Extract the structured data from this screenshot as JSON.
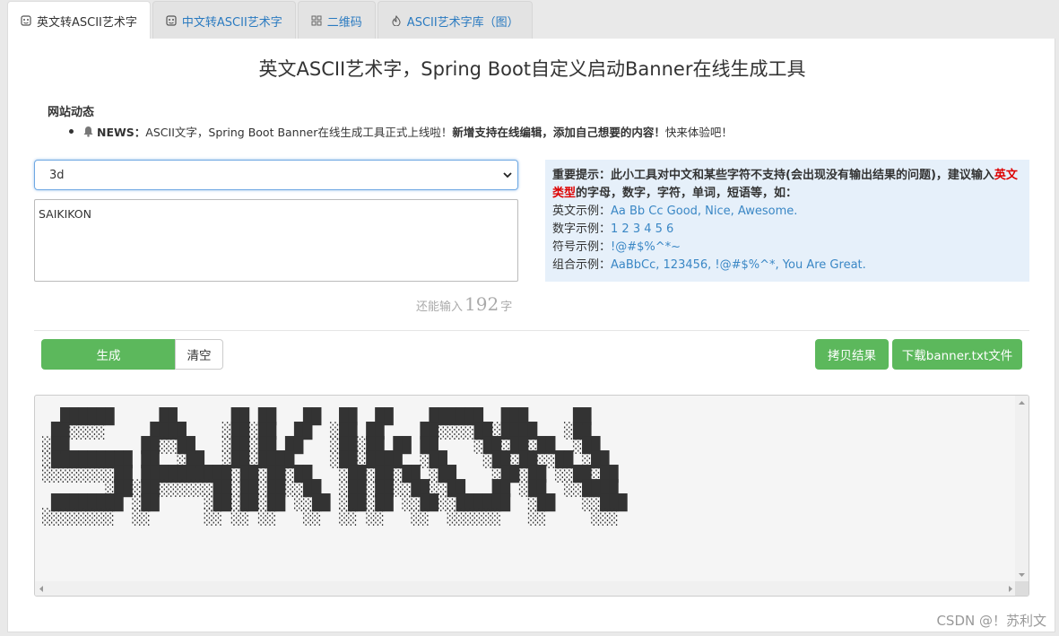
{
  "tabs": [
    {
      "label": "英文转ASCII艺术字",
      "active": true,
      "icon": "ascii-face-icon"
    },
    {
      "label": "中文转ASCII艺术字",
      "active": false,
      "icon": "ascii-face-icon"
    },
    {
      "label": "二维码",
      "active": false,
      "icon": "qrcode-icon"
    },
    {
      "label": "ASCII艺术字库（图）",
      "active": false,
      "icon": "fire-icon"
    }
  ],
  "title": "英文ASCII艺术字，Spring Boot自定义启动Banner在线生成工具",
  "news": {
    "heading": "网站动态",
    "tag": "NEWS：",
    "text1": "ASCII文字，Spring Boot Banner在线生成工具正式上线啦！",
    "text2": "新增支持在线编辑，添加自己想要的内容！",
    "text3": "快来体验吧！"
  },
  "form": {
    "font_selected": "3d",
    "input_text": "SAIKIKON",
    "counter_prefix": "还能输入",
    "counter_value": "192",
    "counter_suffix": "字"
  },
  "tip": {
    "line1_bold": "重要提示：此小工具对中文和某些字符不支持(会出现没有输出结果的问题)，建议输入",
    "line1_red": "英文类型",
    "line1_tail": "的字母，数字，字符，单词，短语等，如：",
    "examples": [
      {
        "label": "英文示例：",
        "value": "Aa Bb Cc Good, Nice, Awesome."
      },
      {
        "label": "数字示例：",
        "value": "1 2 3 4 5 6"
      },
      {
        "label": "符号示例：",
        "value": "!@#$%^*~"
      },
      {
        "label": "组合示例：",
        "value": "AaBbCc, 123456, !@#$%^*, You Are Great."
      }
    ]
  },
  "buttons": {
    "generate": "生成",
    "clear": "清空",
    "copy": "拷贝结果",
    "download": "下载banner.txt文件"
  },
  "output": {
    "ascii": "  ██████     ██      ██ ██   ██  ██  ██    ██████  ███     ██\n ██░░░░     ████    ░██░██  ██  ░██ ██    ██░░░░██░████   ░██\n░██        ██░░██   ░██░██ ██   ░██░██ ██ ██    ░██░██░██  ░██\n░█████████ ██  ░██  ░██░████    ░██░████  ░██    ░██░██░░██ ░██\n░░░░░░░░██ ██████████░██░██░██   ░██░██░██ ░██    ░██░██ ░░██░██\n       ░██░██░░░░░░██░██░██░░██  ░██░██░░██░░██   ██ ░██  ░░████\n ████████ ░██     ░██░██░██ ░░██ ░██░██ ░░██░░██████  ░██   ░░███\n░░░░░░░░  ░░      ░░ ░░ ░░   ░░  ░░ ░░   ░░  ░░░░░░   ░░     ░░░"
  },
  "watermark": "CSDN @！苏利文"
}
